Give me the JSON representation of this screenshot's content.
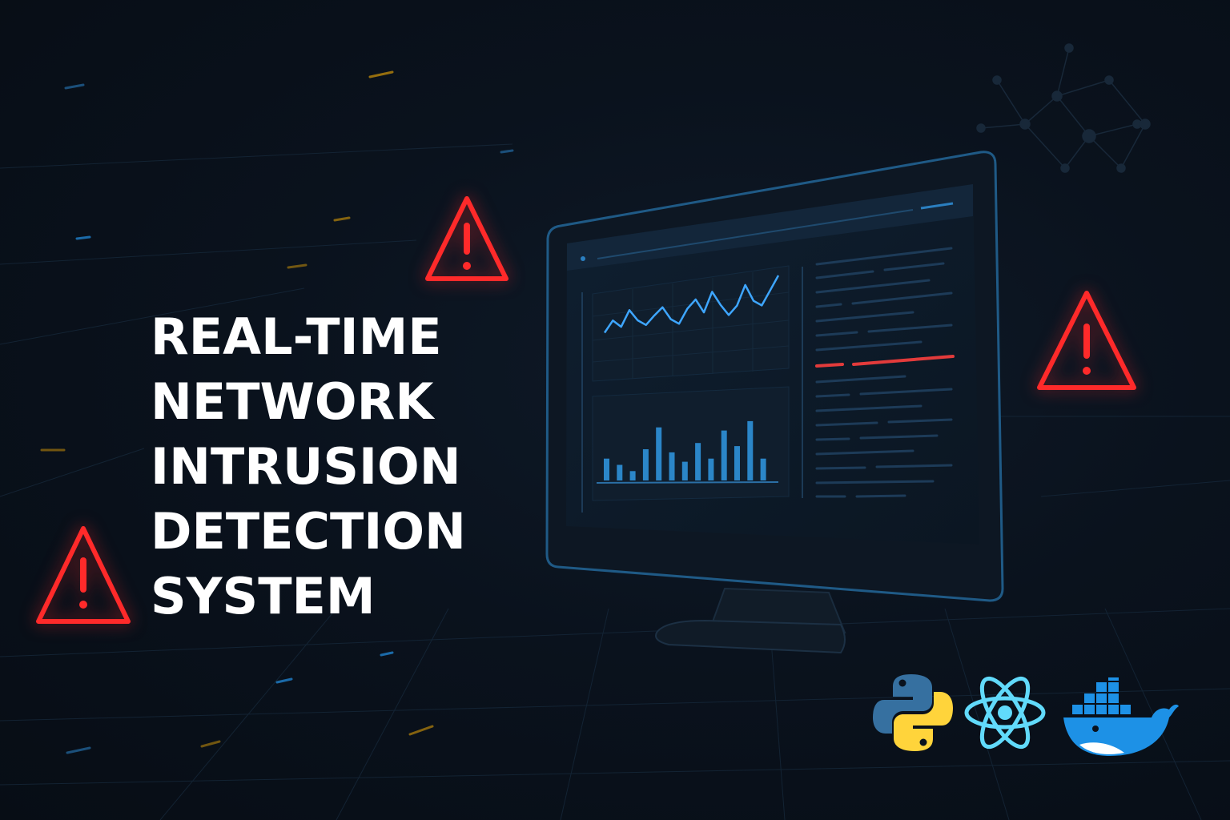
{
  "headline": {
    "lines": [
      "REAL-TIME",
      "NETWORK",
      "INTRUSION",
      "DETECTION",
      "SYSTEM"
    ]
  },
  "icons": {
    "warning": "warning-triangle-icon",
    "tech": [
      "python-logo",
      "react-logo",
      "docker-logo"
    ]
  },
  "colors": {
    "background": "#0a121d",
    "headline": "#ffffff",
    "warning": "#ff2a2a",
    "accent": "#3ea6ff",
    "python_blue": "#3670a0",
    "python_yellow": "#ffd43b",
    "react": "#61dafb",
    "docker": "#1d91e6"
  },
  "dashboard": {
    "line_chart": [
      0.35,
      0.55,
      0.42,
      0.7,
      0.5,
      0.4,
      0.55,
      0.68,
      0.45,
      0.35,
      0.6,
      0.75,
      0.5,
      0.85,
      0.6,
      0.4,
      0.55,
      0.9,
      0.6,
      0.5,
      0.75,
      1.0
    ],
    "bar_chart": [
      0.35,
      0.25,
      0.15,
      0.5,
      0.85,
      0.45,
      0.3,
      0.6,
      0.35,
      0.8,
      0.55,
      0.95,
      0.35
    ]
  }
}
